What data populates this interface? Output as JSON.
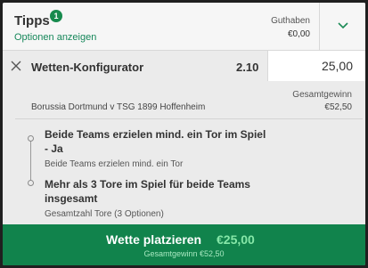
{
  "header": {
    "title": "Tipps",
    "badge_count": "1",
    "show_options": "Optionen anzeigen",
    "balance_label": "Guthaben",
    "balance_value": "€0,00",
    "collapse_icon": "chevron-down-icon"
  },
  "bet": {
    "close_icon": "close-icon",
    "title": "Wetten-Konfigurator",
    "odds": "2.10",
    "stake": "25,00",
    "total_win_label": "Gesamtgewinn",
    "total_win_value": "€52,50",
    "match": "Borussia Dortmund v TSG 1899 Hoffenheim"
  },
  "selections": [
    {
      "title": "Beide Teams erzielen mind. ein Tor im Spiel - Ja",
      "subtitle": "Beide Teams erzielen mind. ein Tor"
    },
    {
      "title": "Mehr als 3 Tore im Spiel für beide Teams insgesamt",
      "subtitle": "Gesamtzahl Tore (3 Optionen)"
    }
  ],
  "place_bet": {
    "label": "Wette platzieren",
    "amount": "€25,00",
    "subtitle": "Gesamtgewinn €52,50"
  },
  "colors": {
    "accent": "#11834c",
    "link": "#16875a",
    "amount_highlight": "#86e7a8"
  }
}
